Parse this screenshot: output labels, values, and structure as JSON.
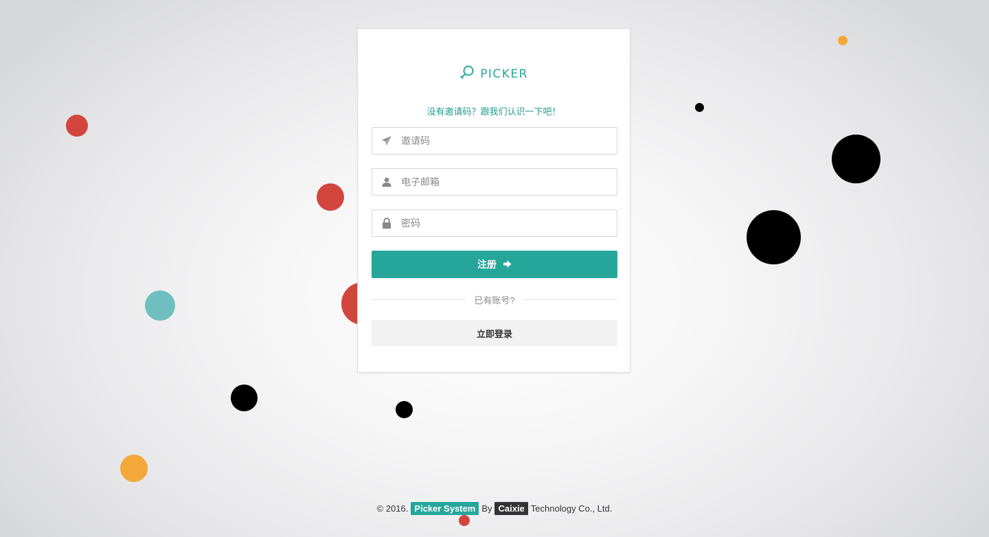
{
  "brand": {
    "name": "PICKER",
    "accent_color": "#26a69a"
  },
  "form": {
    "tagline": "没有邀请码？跟我们认识一下吧！",
    "invite_code": {
      "placeholder": "邀请码",
      "icon": "paper-plane-icon"
    },
    "email": {
      "placeholder": "电子邮箱",
      "icon": "user-icon"
    },
    "password": {
      "placeholder": "密码",
      "icon": "lock-icon"
    },
    "register_label": "注册",
    "register_icon": "arrow-right-icon",
    "divider_text": "已有账号?",
    "login_label": "立即登录"
  },
  "footer": {
    "copyright": "© 2016.",
    "product": "Picker System",
    "by": "By",
    "company": "Caixie",
    "suffix": "Technology Co., Ltd."
  },
  "decoration": {
    "bubble_colors": {
      "red": "#d2463e",
      "orange": "#f5a83a",
      "teal": "#6fbfc0",
      "black": "#000000"
    }
  }
}
